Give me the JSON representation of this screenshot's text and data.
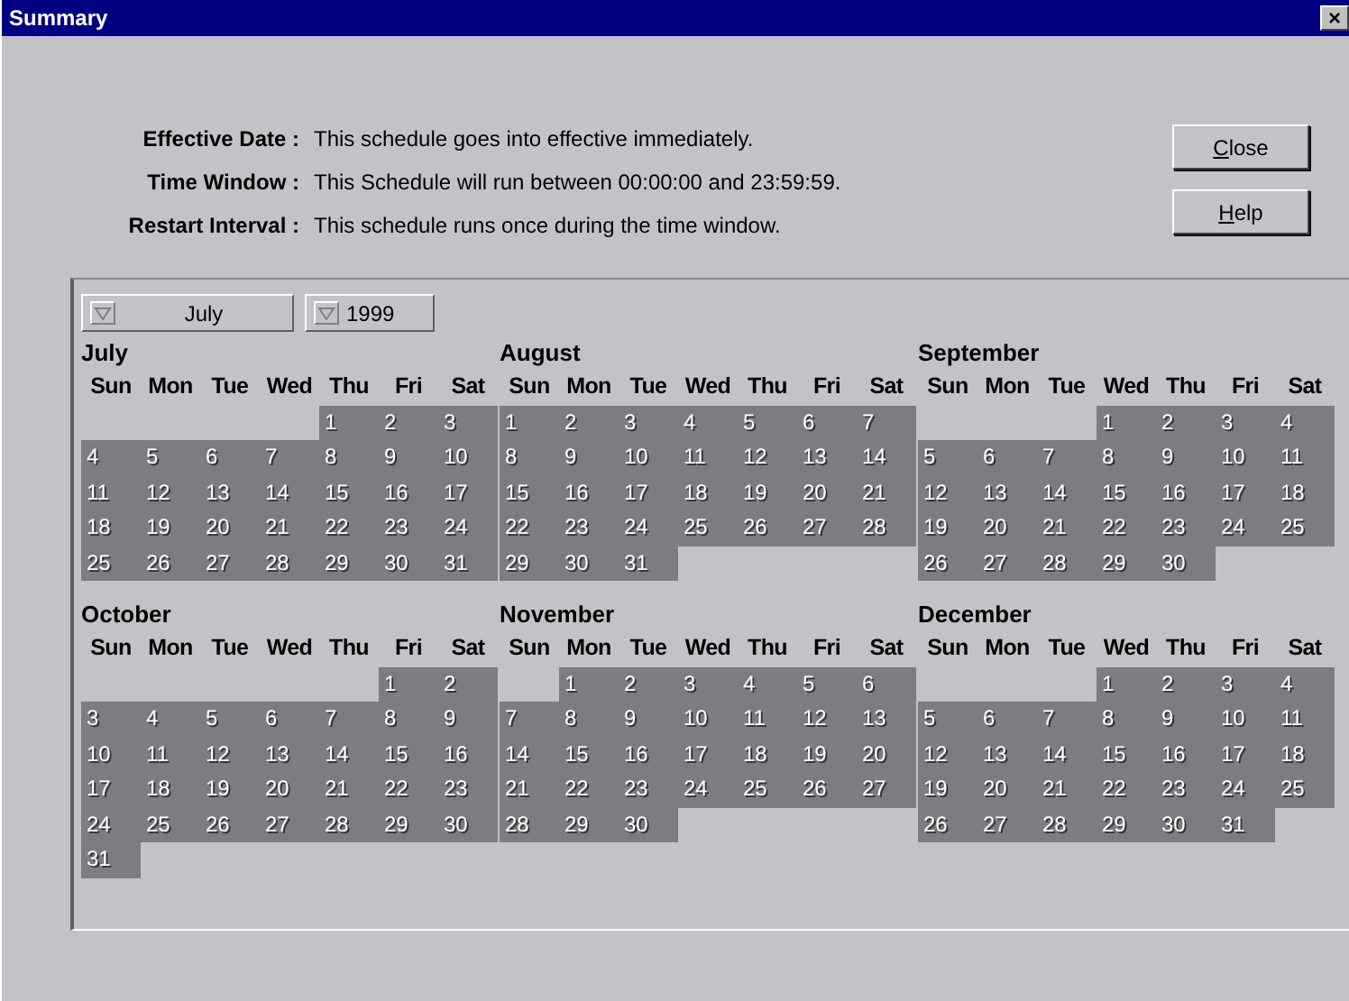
{
  "window": {
    "title": "Summary",
    "close_glyph": "×"
  },
  "info": [
    {
      "label": "Effective Date :",
      "value": "This schedule goes into effective immediately."
    },
    {
      "label": "Time Window :",
      "value": "This Schedule will run between 00:00:00 and 23:59:59."
    },
    {
      "label": "Restart Interval :",
      "value": "This schedule runs once during the time window."
    }
  ],
  "buttons": [
    {
      "label": "Close"
    },
    {
      "label": "Help"
    }
  ],
  "month_select": {
    "value": "July"
  },
  "year_select": {
    "value": "1999"
  },
  "months": [
    {
      "name": "July",
      "selected": true,
      "weekdays": [
        "Sun",
        "Mon",
        "Tue",
        "Wed",
        "Thu",
        "Fri",
        "Sat"
      ],
      "weeks": [
        [
          "1",
          "2",
          "3"
        ],
        [
          "4",
          "5",
          "6",
          "7",
          "8",
          "9",
          "10"
        ],
        [
          "11",
          "12",
          "13",
          "14",
          "15",
          "16",
          "17"
        ],
        [
          "18",
          "19",
          "20",
          "21",
          "22",
          "23",
          "24"
        ],
        [
          "25",
          "26",
          "27",
          "28",
          "29",
          "30",
          "31"
        ]
      ]
    },
    {
      "name": "August",
      "selected": true,
      "weekdays": [
        "Sun",
        "Mon",
        "Tue",
        "Wed",
        "Thu",
        "Fri",
        "Sat"
      ],
      "weeks": [
        [
          "1",
          "2",
          "3",
          "4",
          "5",
          "6",
          "7"
        ],
        [
          "8",
          "9",
          "10",
          "11",
          "12",
          "13",
          "14"
        ],
        [
          "15",
          "16",
          "17",
          "18",
          "19",
          "20",
          "21"
        ],
        [
          "22",
          "23",
          "24",
          "25",
          "26",
          "27",
          "28"
        ],
        [
          "29",
          "30",
          "31"
        ]
      ]
    },
    {
      "name": "September",
      "selected": true,
      "weekdays": [
        "Sun",
        "Mon",
        "Tue",
        "Wed",
        "Thu",
        "Fri",
        "Sat"
      ],
      "weeks": [
        [
          "1",
          "2",
          "3",
          "4"
        ],
        [
          "5",
          "6",
          "7",
          "8",
          "9",
          "10",
          "11"
        ],
        [
          "12",
          "13",
          "14",
          "15",
          "16",
          "17",
          "18"
        ],
        [
          "19",
          "20",
          "21",
          "22",
          "23",
          "24",
          "25"
        ],
        [
          "26",
          "27",
          "28",
          "29",
          "30"
        ]
      ]
    },
    {
      "name": "October",
      "selected": true,
      "weekdays": [
        "Sun",
        "Mon",
        "Tue",
        "Wed",
        "Thu",
        "Fri",
        "Sat"
      ],
      "weeks": [
        [
          "1",
          "2"
        ],
        [
          "3",
          "4",
          "5",
          "6",
          "7",
          "8",
          "9"
        ],
        [
          "10",
          "11",
          "12",
          "13",
          "14",
          "15",
          "16"
        ],
        [
          "17",
          "18",
          "19",
          "20",
          "21",
          "22",
          "23"
        ],
        [
          "24",
          "25",
          "26",
          "27",
          "28",
          "29",
          "30"
        ],
        [
          "31"
        ]
      ]
    },
    {
      "name": "November",
      "selected": true,
      "weekdays": [
        "Sun",
        "Mon",
        "Tue",
        "Wed",
        "Thu",
        "Fri",
        "Sat"
      ],
      "weeks": [
        [
          "1",
          "2",
          "3",
          "4",
          "5",
          "6"
        ],
        [
          "7",
          "8",
          "9",
          "10",
          "11",
          "12",
          "13"
        ],
        [
          "14",
          "15",
          "16",
          "17",
          "18",
          "19",
          "20"
        ],
        [
          "21",
          "22",
          "23",
          "24",
          "25",
          "26",
          "27"
        ],
        [
          "28",
          "29",
          "30"
        ]
      ]
    },
    {
      "name": "December",
      "selected": true,
      "weekdays": [
        "Sun",
        "Mon",
        "Tue",
        "Wed",
        "Thu",
        "Fri",
        "Sat"
      ],
      "weeks": [
        [
          "1",
          "2",
          "3",
          "4"
        ],
        [
          "5",
          "6",
          "7",
          "8",
          "9",
          "10",
          "11"
        ],
        [
          "12",
          "13",
          "14",
          "15",
          "16",
          "17",
          "18"
        ],
        [
          "19",
          "20",
          "21",
          "22",
          "23",
          "24",
          "25"
        ],
        [
          "26",
          "27",
          "28",
          "29",
          "30",
          "31"
        ]
      ]
    }
  ]
}
